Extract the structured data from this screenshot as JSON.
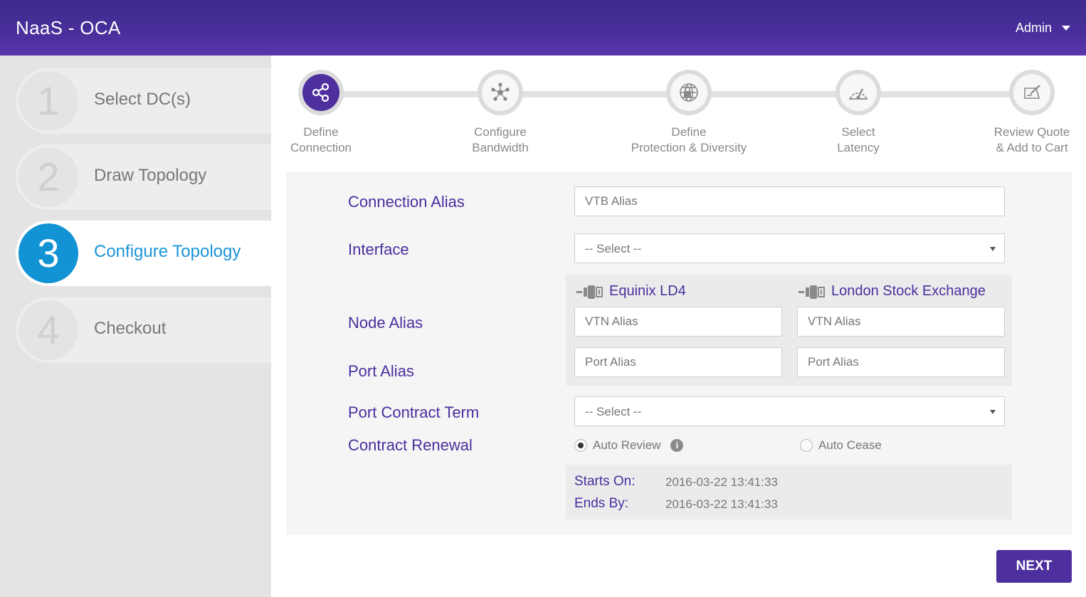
{
  "header": {
    "title": "NaaS - OCA",
    "user": "Admin"
  },
  "sidebar": {
    "steps": [
      {
        "number": "1",
        "label": "Select DC(s)"
      },
      {
        "number": "2",
        "label": "Draw Topology"
      },
      {
        "number": "3",
        "label": "Configure Topology"
      },
      {
        "number": "4",
        "label": "Checkout"
      }
    ],
    "active_step": 3
  },
  "wizard": {
    "steps": [
      {
        "line1": "Define",
        "line2": "Connection",
        "icon": "share-icon"
      },
      {
        "line1": "Configure",
        "line2": "Bandwidth",
        "icon": "network-icon"
      },
      {
        "line1": "Define",
        "line2": "Protection & Diversity",
        "icon": "globe-lock-icon"
      },
      {
        "line1": "Select",
        "line2": "Latency",
        "icon": "speedometer-icon"
      },
      {
        "line1": "Review Quote",
        "line2": "& Add to Cart",
        "icon": "edit-quote-icon"
      }
    ],
    "active": 1
  },
  "form": {
    "connection_alias": {
      "label": "Connection Alias",
      "placeholder": "VTB Alias"
    },
    "interface": {
      "label": "Interface",
      "placeholder": "-- Select --"
    },
    "node_alias_label": "Node Alias",
    "port_alias_label": "Port Alias",
    "nodes": [
      {
        "name": "Equinix LD4",
        "node_placeholder": "VTN Alias",
        "port_placeholder": "Port Alias"
      },
      {
        "name": "London Stock Exchange",
        "node_placeholder": "VTN Alias",
        "port_placeholder": "Port Alias"
      }
    ],
    "port_contract_term": {
      "label": "Port Contract Term",
      "placeholder": "-- Select --"
    },
    "contract_renewal": {
      "label": "Contract Renewal",
      "options": [
        {
          "label": "Auto Review",
          "selected": true
        },
        {
          "label": "Auto Cease",
          "selected": false
        }
      ]
    },
    "dates": {
      "starts_label": "Starts On:",
      "starts_value": "2016-03-22 13:41:33",
      "ends_label": "Ends By:",
      "ends_value": "2016-03-22 13:41:33"
    }
  },
  "next_button": "NEXT",
  "colors": {
    "brand": "#4d2f9e",
    "accent": "#1293d4"
  }
}
